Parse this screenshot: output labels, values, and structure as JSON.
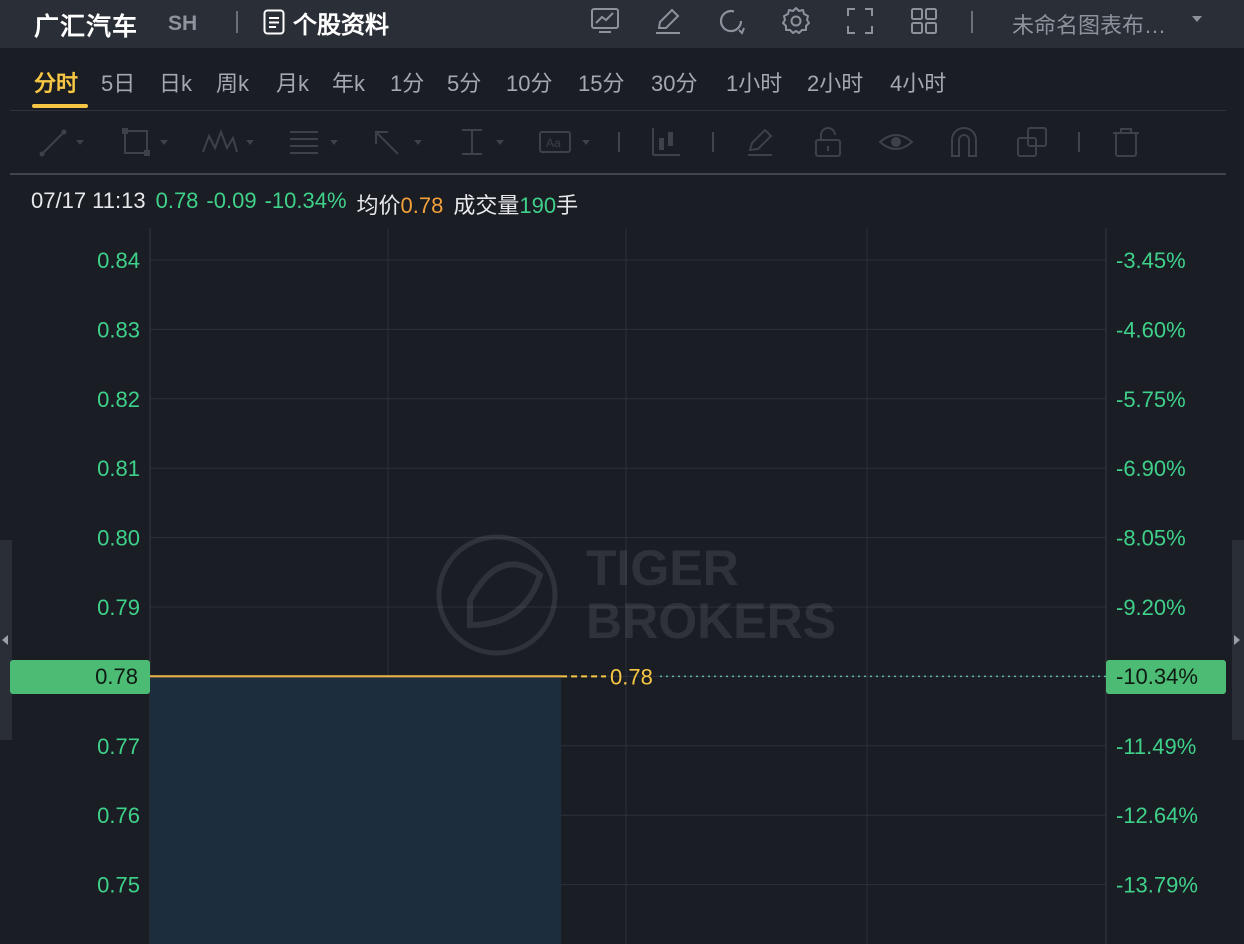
{
  "header": {
    "stock_name": "广汇汽车",
    "exchange": "SH",
    "info_label": "个股资料",
    "layout_name": "未命名图表布…"
  },
  "tabs": [
    {
      "label": "分时",
      "active": true
    },
    {
      "label": "5日"
    },
    {
      "label": "日k"
    },
    {
      "label": "周k"
    },
    {
      "label": "月k"
    },
    {
      "label": "年k"
    },
    {
      "label": "1分"
    },
    {
      "label": "5分"
    },
    {
      "label": "10分"
    },
    {
      "label": "15分"
    },
    {
      "label": "30分"
    },
    {
      "label": "1小时"
    },
    {
      "label": "2小时"
    },
    {
      "label": "4小时"
    }
  ],
  "quote": {
    "datetime": "07/17 11:13",
    "price": "0.78",
    "change": "-0.09",
    "change_pct": "-10.34%",
    "avg_label": "均价",
    "avg_value": "0.78",
    "volume_label": "成交量",
    "volume_value": "190",
    "volume_unit": "手"
  },
  "watermark": {
    "line1": "TIGER",
    "line2": "BROKERS"
  },
  "current": {
    "price_tag": "0.78",
    "pct_tag": "-10.34%",
    "line_label": "0.78"
  },
  "colors": {
    "up_green": "#3fd18a",
    "tag_green": "#4cbb74",
    "avg_yellow": "#f7c744",
    "accent_orange": "#f2a13a",
    "bg": "#1a1d24"
  },
  "chart_data": {
    "type": "line",
    "title": "",
    "price_ticks": [
      "0.84",
      "0.83",
      "0.82",
      "0.81",
      "0.80",
      "0.79",
      "0.78",
      "0.77",
      "0.76",
      "0.75"
    ],
    "pct_ticks": [
      "-3.45%",
      "-4.60%",
      "-5.75%",
      "-6.90%",
      "-8.05%",
      "-9.20%",
      "-10.34%",
      "-11.49%",
      "-12.64%",
      "-13.79%"
    ],
    "ylim": [
      0.744,
      0.845
    ],
    "series": [
      {
        "name": "",
        "values": [
          0.78,
          0.78
        ]
      }
    ],
    "average": 0.78,
    "session_progress": 0.43,
    "grid": true
  }
}
